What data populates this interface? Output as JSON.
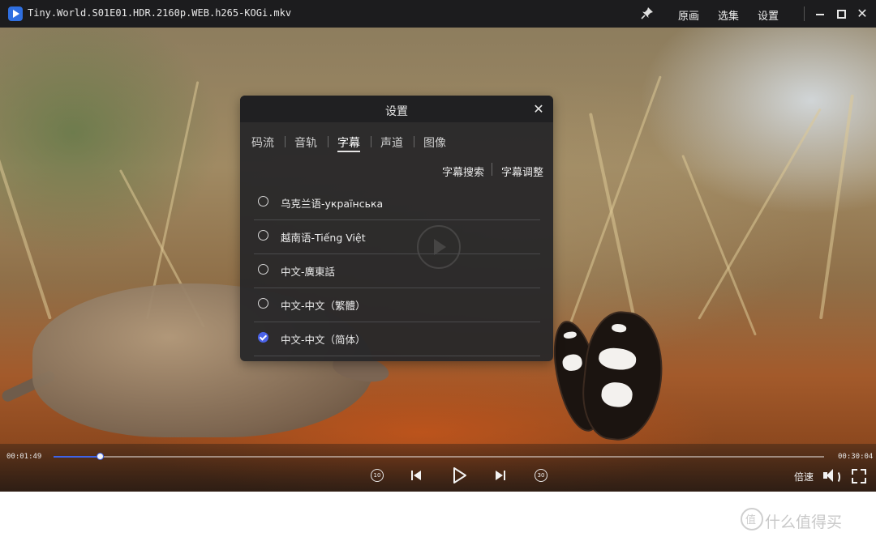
{
  "window": {
    "title": "Tiny.World.S01E01.HDR.2160p.WEB.h265-KOGi.mkv",
    "menu": [
      "原画",
      "选集",
      "设置"
    ],
    "controls": {
      "minimize": "minimize",
      "maximize": "maximize",
      "close": "✕"
    }
  },
  "settings_dialog": {
    "title": "设置",
    "close_label": "✕",
    "tabs": [
      "码流",
      "音轨",
      "字幕",
      "声道",
      "图像"
    ],
    "active_tab": "字幕",
    "actions": [
      "字幕搜索",
      "字幕调整"
    ],
    "subtitles": [
      {
        "label": "乌克兰语-українська",
        "selected": false
      },
      {
        "label": "越南语-Tiếng Việt",
        "selected": false
      },
      {
        "label": "中文-廣東話",
        "selected": false
      },
      {
        "label": "中文-中文（繁體）",
        "selected": false
      },
      {
        "label": "中文-中文（简体）",
        "selected": true
      }
    ]
  },
  "playback": {
    "current_time": "00:01:49",
    "total_time": "00:30:04",
    "progress_fraction": 0.0604,
    "rewind_label": "10",
    "forward_label": "30",
    "speed_label": "倍速"
  },
  "watermark": {
    "text": "什么值得买"
  },
  "colors": {
    "accent": "#3e63e8",
    "titlebar": "#1c1c1e",
    "dialog": "#262628"
  },
  "icons": {
    "app": "player-logo-icon",
    "pin": "pin-icon",
    "rewind": "rewind-10-icon",
    "prev": "previous-icon",
    "play": "play-icon",
    "next": "next-icon",
    "forward": "forward-30-icon",
    "volume": "volume-icon",
    "fullscreen": "fullscreen-icon"
  }
}
